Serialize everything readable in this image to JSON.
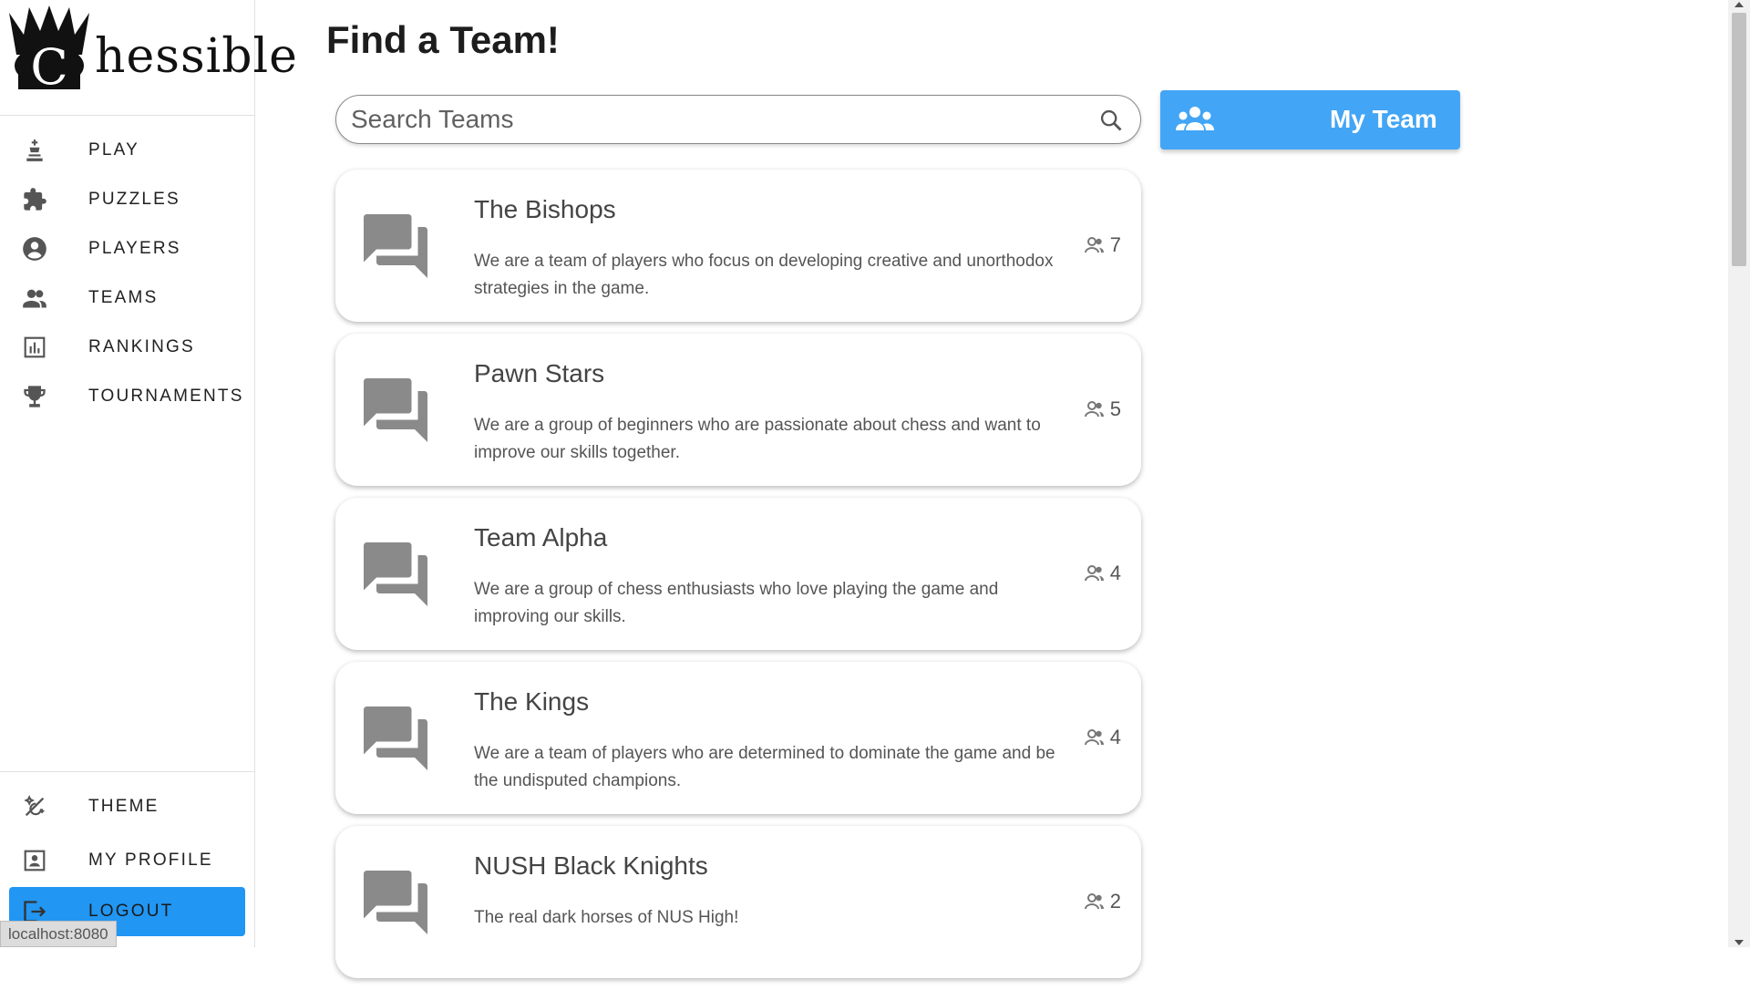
{
  "app": {
    "logo_text": "hessible",
    "logo_letter": "C"
  },
  "sidebar": {
    "items": [
      {
        "label": "PLAY",
        "icon": "chess-king-icon"
      },
      {
        "label": "PUZZLES",
        "icon": "puzzle-icon"
      },
      {
        "label": "PLAYERS",
        "icon": "account-circle-icon"
      },
      {
        "label": "TEAMS",
        "icon": "people-icon"
      },
      {
        "label": "RANKINGS",
        "icon": "bar-chart-icon"
      },
      {
        "label": "TOURNAMENTS",
        "icon": "trophy-icon"
      }
    ],
    "bottom_items": [
      {
        "label": "THEME",
        "icon": "theme-icon"
      },
      {
        "label": "MY PROFILE",
        "icon": "profile-icon"
      },
      {
        "label": "LOGOUT",
        "icon": "logout-icon",
        "active": true
      }
    ]
  },
  "status_tip": "localhost:8080",
  "main": {
    "title": "Find a Team!",
    "search": {
      "placeholder": "Search Teams",
      "value": ""
    },
    "my_team_label": "My Team",
    "teams": [
      {
        "name": "The Bishops",
        "description": "We are a team of players who focus on developing creative and unorthodox strategies in the game.",
        "members": "7"
      },
      {
        "name": "Pawn Stars",
        "description": "We are a group of beginners who are passionate about chess and want to improve our skills together.",
        "members": "5"
      },
      {
        "name": "Team Alpha",
        "description": "We are a group of chess enthusiasts who love playing the game and improving our skills.",
        "members": "4"
      },
      {
        "name": "The Kings",
        "description": "We are a team of players who are determined to dominate the game and be the undisputed champions.",
        "members": "4"
      },
      {
        "name": "NUSH Black Knights",
        "description": "The real dark horses of NUS High!",
        "members": "2"
      }
    ]
  },
  "colors": {
    "accent": "#2196f3",
    "my_team_button": "#42a5f5",
    "icon_gray": "#8a8a8a"
  }
}
